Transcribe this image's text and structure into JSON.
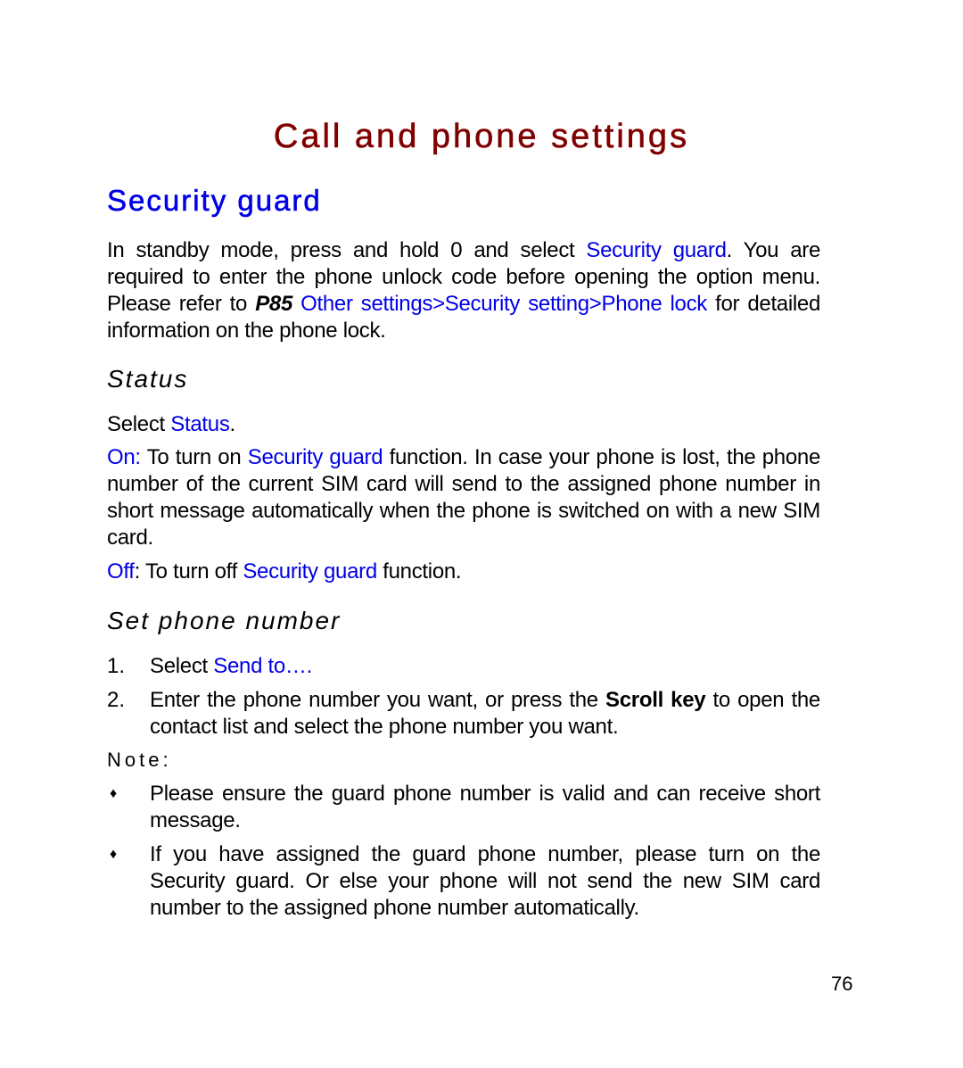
{
  "page": {
    "title": "Call and phone settings",
    "section_title": "Security guard",
    "page_number": "76"
  },
  "intro": {
    "t1": "In standby mode, press and hold 0 and select ",
    "link1": "Security guard",
    "t2": ". You are required to enter the phone unlock code before opening the option menu. Please refer to ",
    "ref": "P85",
    "t3": " ",
    "link2": "Other settings>Security setting>Phone lock",
    "t4": " for detailed information on the phone lock."
  },
  "status": {
    "heading": "Status",
    "select_prefix": "Select ",
    "select_link": "Status",
    "select_suffix": ".",
    "on_label": "On:",
    "on_t1": " To turn on ",
    "on_link": "Security guard",
    "on_t2": " function. In case your phone is lost, the phone number of the current SIM card will send to the assigned phone number in short message automatically when the phone is switched on with a new SIM card.",
    "off_label": "Off",
    "off_t1": ": To turn off ",
    "off_link": "Security guard",
    "off_t2": " function."
  },
  "set_phone": {
    "heading": "Set phone number",
    "steps": [
      {
        "marker": "1.",
        "prefix": "Select ",
        "link": "Send to…."
      },
      {
        "marker": "2.",
        "t1": "Enter the phone number you want, or press the ",
        "bold": "Scroll key",
        "t2": " to open the contact list and select the phone number you want."
      }
    ]
  },
  "note": {
    "label": "Note:",
    "bullet_icon": "diamond-bullet",
    "bullet_glyph": "♦",
    "items": [
      "Please ensure the guard phone number is valid and can receive short message.",
      "If you have assigned the guard phone number, please turn on the Security guard. Or else your phone will not send the new SIM card number to the assigned phone number automatically."
    ]
  },
  "colors": {
    "title": "#800000",
    "link": "#0000e6",
    "text": "#000000"
  }
}
